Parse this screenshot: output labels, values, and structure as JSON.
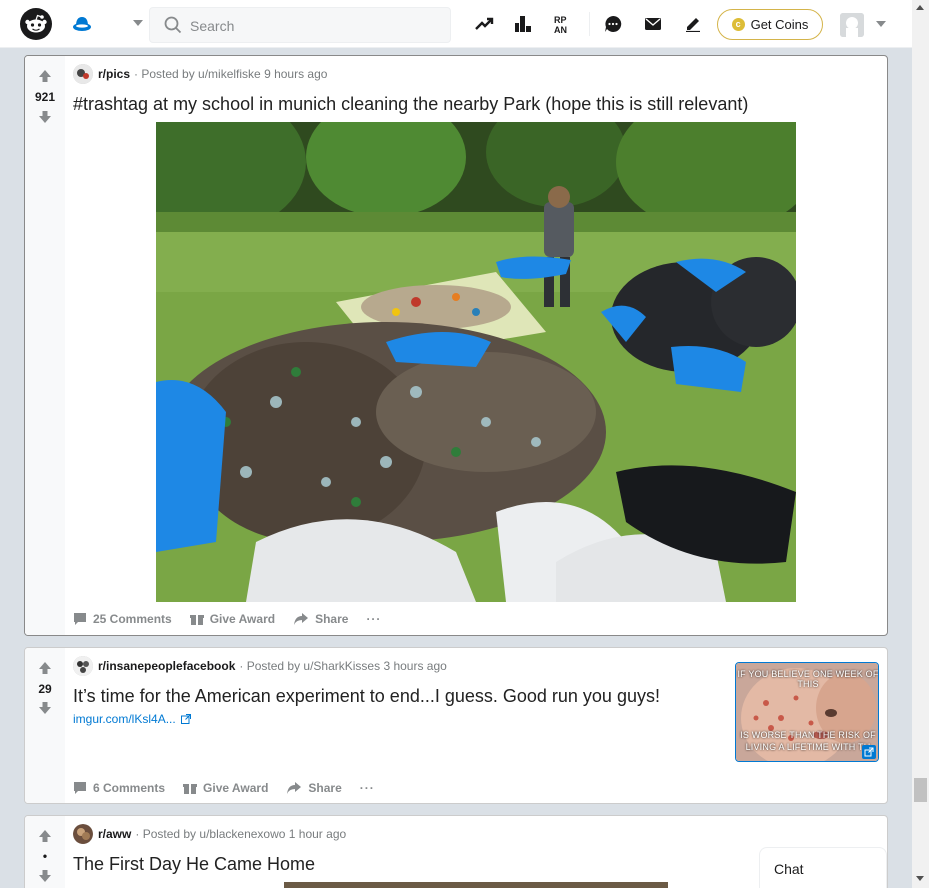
{
  "header": {
    "search_placeholder": "Search",
    "get_coins_label": "Get Coins",
    "coin_symbol": "c",
    "accent_color": "#0079d3"
  },
  "posts": [
    {
      "subreddit": "r/pics",
      "posted_by": "· Posted by u/mikelfiske 9 hours ago",
      "score": "921",
      "title": "#trashtag at my school in munich cleaning the nearby Park (hope this is still relevant)",
      "comments": "25 Comments",
      "award": "Give Award",
      "share": "Share",
      "more": "···"
    },
    {
      "subreddit": "r/insanepeoplefacebook",
      "posted_by": "· Posted by u/SharkKisses 3 hours ago",
      "score": "29",
      "title": "It’s time for the American experiment to end...I guess. Good run you guys!",
      "link": "imgur.com/lKsl4A...",
      "thumbnail_top_text": "IF YOU BELIEVE ONE WEEK OF THIS",
      "thumbnail_bottom_text_1": "IS WORSE THAN THE RISK OF",
      "thumbnail_bottom_text_2": "LIVING A LIFETIME WITH TH",
      "comments": "6 Comments",
      "award": "Give Award",
      "share": "Share",
      "more": "···"
    },
    {
      "subreddit": "r/aww",
      "posted_by": "· Posted by u/blackenexowo 1 hour ago",
      "score": "•",
      "title": "The First Day He Came Home"
    }
  ],
  "chat": {
    "label": "Chat"
  }
}
